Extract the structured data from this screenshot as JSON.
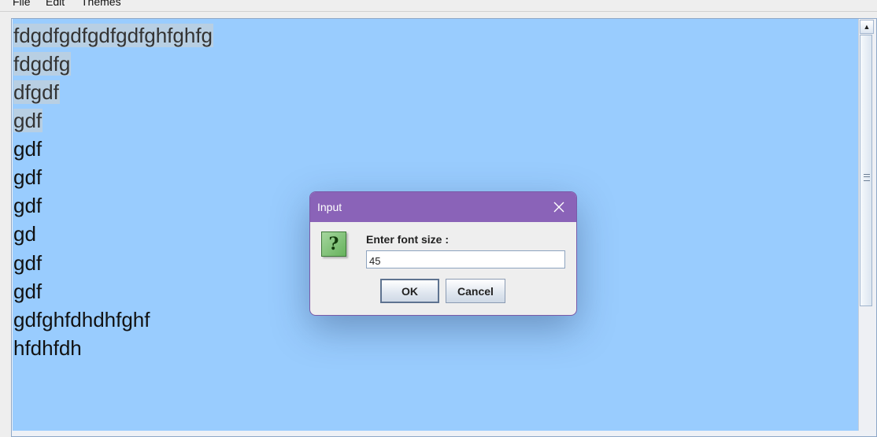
{
  "menubar": {
    "items": [
      "File",
      "Edit",
      "Themes"
    ]
  },
  "editor": {
    "lines": [
      {
        "text": "fdgdfgdfgdfgdfghfghfg",
        "selected": true
      },
      {
        "text": "fdgdfg",
        "selected": true
      },
      {
        "text": "dfgdf",
        "selected": true
      },
      {
        "text": "gdf",
        "selected": true
      },
      {
        "text": "gdf",
        "selected": false
      },
      {
        "text": "gdf",
        "selected": false
      },
      {
        "text": "gdf",
        "selected": false
      },
      {
        "text": "gd",
        "selected": false
      },
      {
        "text": "gdf",
        "selected": false
      },
      {
        "text": "gdf",
        "selected": false
      },
      {
        "text": "gdfghfdhdhfghf",
        "selected": false
      },
      {
        "text": "hfdhfdh",
        "selected": false
      }
    ],
    "background_color": "#99ccfe"
  },
  "dialog": {
    "title": "Input",
    "prompt": "Enter font size :",
    "input_value": "45",
    "ok_label": "OK",
    "cancel_label": "Cancel",
    "icon": "question-icon",
    "titlebar_color": "#8a63b8"
  }
}
